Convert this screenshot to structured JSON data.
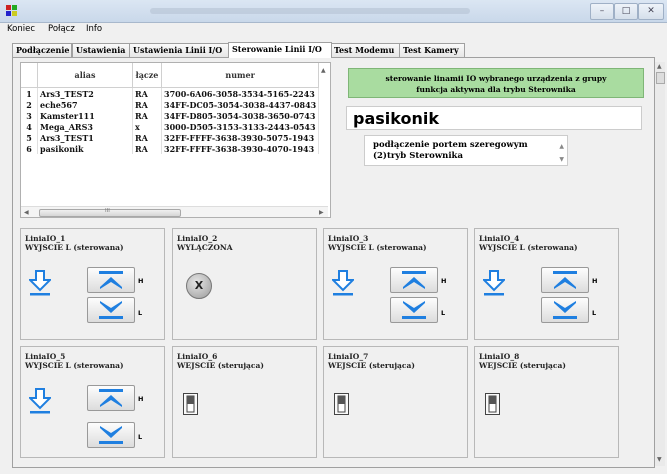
{
  "menu": {
    "items": [
      "Koniec",
      "Połącz",
      "Info"
    ]
  },
  "tabs": [
    "Podłączenie",
    "Ustawienia",
    "Ustawienia Linii I/O",
    "Sterowanie Linii I/O",
    "Test Modemu",
    "Test Kamery"
  ],
  "active_tab": "Sterowanie Linii I/O",
  "table": {
    "headers": [
      "",
      "alias",
      "łącze",
      "numer"
    ],
    "rows": [
      [
        "1",
        "Ars3_TEST2",
        "RA",
        "3700-6A06-3058-3534-5165-2243"
      ],
      [
        "2",
        "eche567",
        "RA",
        "34FF-DC05-3054-3038-4437-0843"
      ],
      [
        "3",
        "Kamster111",
        "RA",
        "34FF-D805-3054-3038-3650-0743"
      ],
      [
        "4",
        "Mega_ARS3",
        "x",
        "3000-D505-3153-3133-2443-0543"
      ],
      [
        "5",
        "Ars3_TEST1",
        "RA",
        "32FF-FFFF-3638-3930-5075-1943"
      ],
      [
        "6",
        "pasikonik",
        "RA",
        "32FF-FFFF-3638-3930-4070-1943"
      ]
    ],
    "scroll_mark": "III"
  },
  "green_info": {
    "line1": "sterowanie linamii IO wybranego urządzenia z grupy",
    "line2": "funkcja aktywna dla trybu Sterownika"
  },
  "device_name": "pasikonik",
  "info_box": {
    "line1": "podłączenie portem szeregowym",
    "line2": "(2)tryb Sterownika"
  },
  "io_cards": [
    {
      "name": "LiniaIO_1",
      "mode": "WYJSCIE L (sterowana)",
      "type": "output"
    },
    {
      "name": "LiniaIO_2",
      "mode": "WYLĄCZONA",
      "type": "off"
    },
    {
      "name": "LiniaIO_3",
      "mode": "WYJSCIE L (sterowana)",
      "type": "output"
    },
    {
      "name": "LiniaIO_4",
      "mode": "WYJSCIE L (sterowana)",
      "type": "output"
    },
    {
      "name": "LiniaIO_5",
      "mode": "WYJSCIE L (sterowana)",
      "type": "output"
    },
    {
      "name": "LiniaIO_6",
      "mode": "WEJSCIE (sterująca)",
      "type": "input"
    },
    {
      "name": "LiniaIO_7",
      "mode": "WEJSCIE (sterująca)",
      "type": "input"
    },
    {
      "name": "LiniaIO_8",
      "mode": "WEJSCIE (sterująca)",
      "type": "input"
    }
  ],
  "labels": {
    "high": "H",
    "low": "L",
    "off_symbol": "X"
  },
  "icons": {
    "app": "app-icon",
    "minimize": "minimize-icon",
    "maximize": "maximize-icon",
    "close": "close-icon",
    "state_down": "arrow-down-to-line-icon",
    "set_high": "double-chevron-up-icon",
    "set_low": "double-chevron-down-icon",
    "toggle": "toggle-switch-icon"
  },
  "colors": {
    "blue": "#1f7fe0",
    "green": "#a9dca0"
  }
}
